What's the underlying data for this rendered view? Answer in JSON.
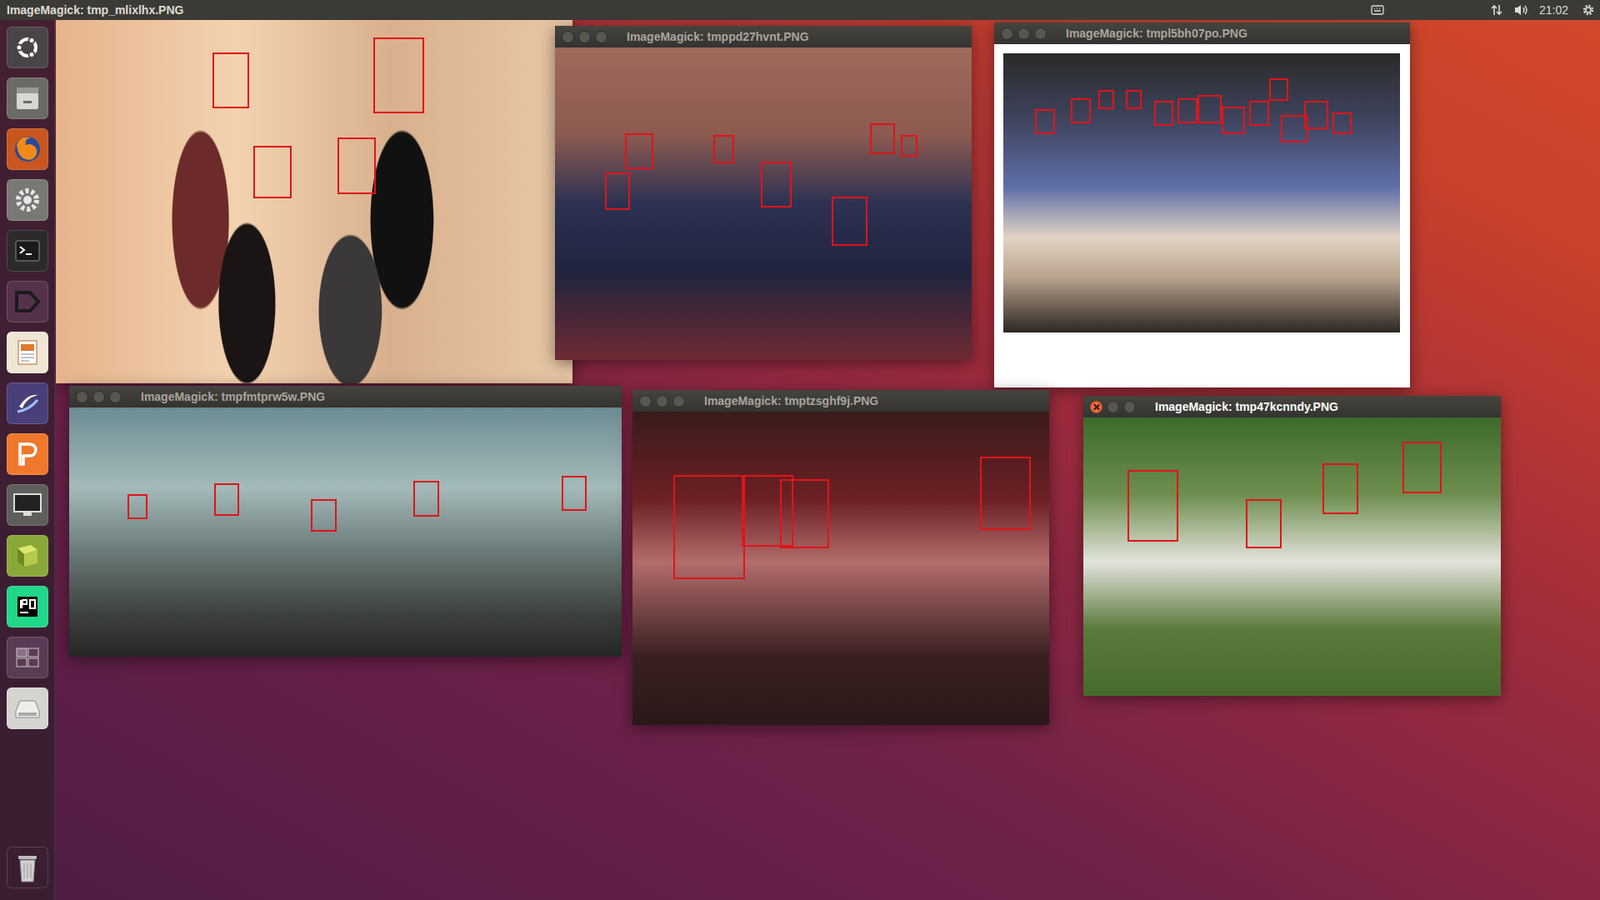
{
  "top_bar": {
    "title": "ImageMagick: tmp_mlixlhx.PNG",
    "clock": "21:02"
  },
  "windows": [
    {
      "kind": "bare"
    },
    {
      "kind": "framed",
      "title": "ImageMagick: tmppd27hvnt.PNG",
      "active": false
    },
    {
      "kind": "framed",
      "title": "ImageMagick: tmpl5bh07po.PNG",
      "active": false
    },
    {
      "kind": "framed",
      "title": "ImageMagick: tmpfmtprw5w.PNG",
      "active": false
    },
    {
      "kind": "framed",
      "title": "ImageMagick: tmptzsghf9j.PNG",
      "active": false
    },
    {
      "kind": "framed",
      "title": "ImageMagick: tmp47kcnndy.PNG",
      "active": true
    }
  ]
}
